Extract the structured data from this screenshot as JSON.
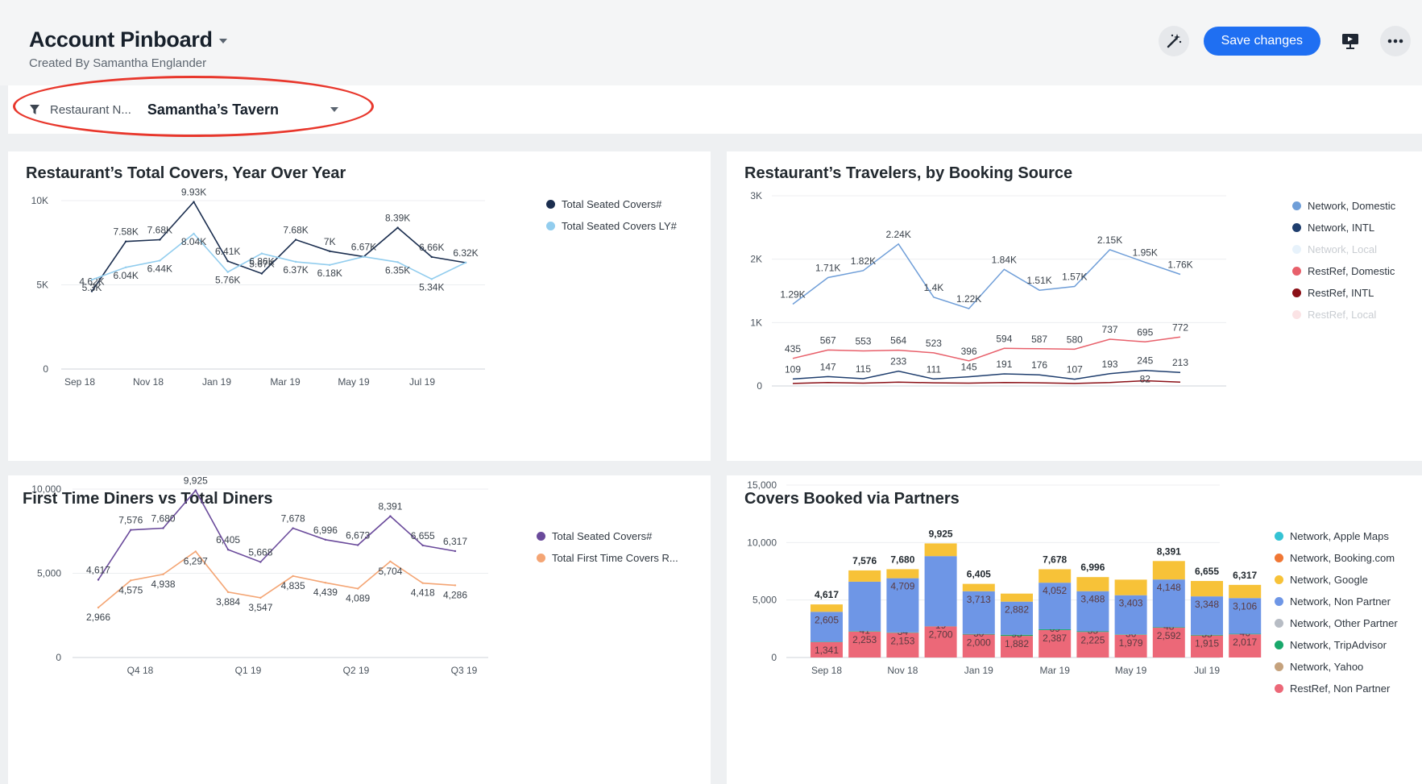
{
  "header": {
    "title": "Account Pinboard",
    "subtitle": "Created By Samantha Englander",
    "save_label": "Save changes",
    "icons": [
      "magic-wand-icon",
      "present-icon",
      "more-icon"
    ]
  },
  "filter": {
    "label": "Restaurant N...",
    "value": "Samantha’s Tavern"
  },
  "colors": {
    "accent": "#1f6ff2",
    "highlight": "#e8372c"
  },
  "cards": {
    "covers_yoy": {
      "title": "Restaurant’s Total Covers, Year Over Year",
      "legend": [
        {
          "label": "Total Seated Covers#",
          "color": "#1b2e4f"
        },
        {
          "label": "Total Seated Covers LY#",
          "color": "#92cdee"
        }
      ]
    },
    "travelers": {
      "title": "Restaurant’s Travelers, by Booking Source",
      "legend": [
        {
          "label": "Network, Domestic",
          "color": "#6f9ed8",
          "faded": false
        },
        {
          "label": "Network, INTL",
          "color": "#1f3e6e",
          "faded": false
        },
        {
          "label": "Network, Local",
          "color": "#e7f2fb",
          "faded": true
        },
        {
          "label": "RestRef, Domestic",
          "color": "#e8606b",
          "faded": false
        },
        {
          "label": "RestRef, INTL",
          "color": "#8b1017",
          "faded": false
        },
        {
          "label": "RestRef, Local",
          "color": "#fbe3e5",
          "faded": true
        }
      ]
    },
    "first_time": {
      "title": "First Time Diners vs Total Diners",
      "legend": [
        {
          "label": "Total Seated Covers#",
          "color": "#6a4a9b"
        },
        {
          "label": "Total First Time Covers R...",
          "color": "#f4a574"
        }
      ]
    },
    "partners": {
      "title": "Covers Booked via Partners",
      "legend": [
        {
          "label": "Network, Apple Maps",
          "color": "#35c3d4"
        },
        {
          "label": "Network, Booking.com",
          "color": "#f07734"
        },
        {
          "label": "Network, Google",
          "color": "#f7c238"
        },
        {
          "label": "Network, Non Partner",
          "color": "#6e96e6"
        },
        {
          "label": "Network, Other Partner",
          "color": "#b7bcc4"
        },
        {
          "label": "Network, TripAdvisor",
          "color": "#19a86b"
        },
        {
          "label": "Network, Yahoo",
          "color": "#c5a27d"
        },
        {
          "label": "RestRef, Non Partner",
          "color": "#ec6878"
        }
      ]
    }
  },
  "chart_data": [
    {
      "id": "covers_yoy",
      "type": "line",
      "title": "Restaurant’s Total Covers, Year Over Year",
      "x_ticks": [
        "Sep 18",
        "Nov 18",
        "Jan 19",
        "Mar 19",
        "May 19",
        "Jul 19"
      ],
      "y_ticks": [
        "0",
        "5K",
        "10K"
      ],
      "ylim": [
        0,
        10000
      ],
      "series": [
        {
          "name": "Total Seated Covers#",
          "color": "#1b2e4f",
          "values": [
            4617,
            7576,
            7680,
            9925,
            6405,
            5668,
            7678,
            6996,
            6673,
            8391,
            6655,
            6317
          ],
          "labels": [
            "4.62K",
            "7.58K",
            "7.68K",
            "9.93K",
            "6.41K",
            "5.67K",
            "7.68K",
            "7K",
            "6.67K",
            "8.39K",
            "6.66K",
            "6.32K"
          ]
        },
        {
          "name": "Total Seated Covers LY#",
          "color": "#92cdee",
          "values": [
            5300,
            6040,
            6440,
            8040,
            5760,
            6860,
            6370,
            6180,
            6670,
            6350,
            5340,
            6320
          ],
          "labels": [
            "5.3K",
            "6.04K",
            "6.44K",
            "8.04K",
            "5.76K",
            "6.86K",
            "6.37K",
            "6.18K",
            "",
            "6.35K",
            "5.34K",
            ""
          ]
        }
      ],
      "grid": true,
      "legend_position": "right"
    },
    {
      "id": "travelers",
      "type": "line",
      "title": "Restaurant’s Travelers, by Booking Source",
      "y_ticks": [
        "0",
        "1K",
        "2K",
        "3K"
      ],
      "ylim": [
        0,
        3000
      ],
      "series": [
        {
          "name": "Network, Domestic",
          "color": "#6f9ed8",
          "values": [
            1290,
            1710,
            1820,
            2240,
            1400,
            1220,
            1840,
            1510,
            1570,
            2150,
            1950,
            1760
          ],
          "labels": [
            "1.29K",
            "1.71K",
            "1.82K",
            "2.24K",
            "1.4K",
            "1.22K",
            "1.84K",
            "1.51K",
            "1.57K",
            "2.15K",
            "1.95K",
            "1.76K"
          ]
        },
        {
          "name": "RestRef, Domestic",
          "color": "#e8606b",
          "values": [
            435,
            567,
            553,
            564,
            523,
            396,
            594,
            587,
            580,
            737,
            695,
            772
          ],
          "labels": [
            "435",
            "567",
            "553",
            "564",
            "523",
            "396",
            "594",
            "587",
            "580",
            "737",
            "695",
            "772"
          ]
        },
        {
          "name": "Network, INTL",
          "color": "#1f3e6e",
          "values": [
            109,
            147,
            115,
            233,
            111,
            145,
            191,
            176,
            107,
            193,
            245,
            213
          ],
          "labels": [
            "109",
            "147",
            "115",
            "233",
            "111",
            "145",
            "191",
            "176",
            "107",
            "193",
            "245",
            "213"
          ]
        },
        {
          "name": "RestRef, INTL",
          "color": "#8b1017",
          "values": [
            40,
            55,
            45,
            60,
            50,
            45,
            55,
            50,
            40,
            55,
            82,
            60
          ],
          "labels": [
            "",
            "",
            "",
            "",
            "",
            "",
            "",
            "",
            "",
            "",
            "82",
            ""
          ]
        }
      ],
      "grid": true,
      "legend_position": "right"
    },
    {
      "id": "first_time",
      "type": "line",
      "title": "First Time Diners vs Total Diners",
      "x_ticks": [
        "Q4 18",
        "Q1 19",
        "Q2 19",
        "Q3 19"
      ],
      "y_ticks": [
        "0",
        "5,000",
        "10,000"
      ],
      "ylim": [
        0,
        10000
      ],
      "series": [
        {
          "name": "Total Seated Covers#",
          "color": "#6a4a9b",
          "values": [
            4617,
            7576,
            7680,
            9925,
            6405,
            5668,
            7678,
            6996,
            6673,
            8391,
            6655,
            6317
          ],
          "labels": [
            "4,617",
            "7,576",
            "7,680",
            "9,925",
            "6,405",
            "5,668",
            "7,678",
            "6,996",
            "6,673",
            "8,391",
            "6,655",
            "6,317"
          ]
        },
        {
          "name": "Total First Time Covers R...",
          "color": "#f4a574",
          "values": [
            2966,
            4575,
            4938,
            6297,
            3884,
            3547,
            4835,
            4439,
            4089,
            5704,
            4418,
            4286
          ],
          "labels": [
            "2,966",
            "4,575",
            "4,938",
            "6,297",
            "3,884",
            "3,547",
            "4,835",
            "4,439",
            "4,089",
            "5,704",
            "4,418",
            "4,286"
          ]
        }
      ],
      "grid": true,
      "legend_position": "right"
    },
    {
      "id": "partners",
      "type": "bar",
      "stacked": true,
      "title": "Covers Booked via Partners",
      "x_ticks": [
        "Sep 18",
        "Nov 18",
        "Jan 19",
        "Mar 19",
        "May 19",
        "Jul 19"
      ],
      "y_ticks": [
        "0",
        "5,000",
        "10,000",
        "15,000"
      ],
      "ylim": [
        0,
        15000
      ],
      "totals": [
        "4,617",
        "7,576",
        "7,680",
        "9,925",
        "6,405",
        "",
        "7,678",
        "6,996",
        "",
        "8,391",
        "6,655",
        "6,317"
      ],
      "series": [
        {
          "name": "RestRef, Non Partner",
          "color": "#ec6878",
          "values": [
            1341,
            2253,
            2153,
            2700,
            2000,
            1882,
            2387,
            2225,
            1979,
            2592,
            1915,
            2017
          ],
          "labels": [
            "1,341",
            "2,253",
            "2,153",
            "2,700",
            "2,000",
            "1,882",
            "2,387",
            "2,225",
            "1,979",
            "2,592",
            "1,915",
            "2,017"
          ]
        },
        {
          "name": "Network, TripAdvisor",
          "color": "#19a86b",
          "values": [
            30,
            41,
            34,
            19,
            50,
            95,
            69,
            55,
            36,
            48,
            55,
            46
          ],
          "labels": [
            "",
            "41",
            "34",
            "19",
            "50",
            "95",
            "69",
            "55",
            "36",
            "48",
            "55",
            "46"
          ]
        },
        {
          "name": "Network, Non Partner",
          "color": "#6e96e6",
          "values": [
            2605,
            4300,
            4709,
            6100,
            3713,
            2882,
            4052,
            3488,
            3403,
            4148,
            3348,
            3106
          ],
          "labels": [
            "2,605",
            "",
            "4,709",
            "",
            "3,713",
            "2,882",
            "4,052",
            "3,488",
            "3,403",
            "4,148",
            "3,348",
            "3,106"
          ]
        },
        {
          "name": "Network, Google",
          "color": "#f7c238",
          "values": [
            641,
            982,
            784,
            1106,
            642,
            700,
            1170,
            1228,
            1355,
            1603,
            1337,
            1148
          ],
          "labels": [
            "",
            "",
            "",
            "",
            "",
            "",
            "",
            "",
            "",
            "",
            "",
            ""
          ]
        }
      ],
      "grid": true,
      "legend_position": "right"
    }
  ]
}
